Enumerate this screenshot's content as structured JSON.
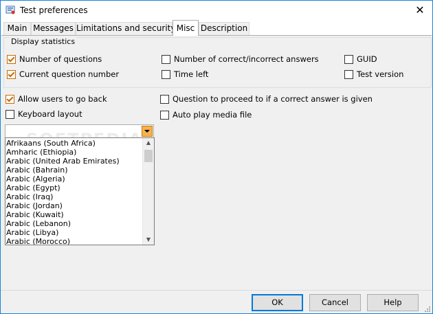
{
  "window": {
    "title": "Test preferences"
  },
  "tabs": [
    {
      "label": "Main",
      "active": false
    },
    {
      "label": "Messages",
      "active": false
    },
    {
      "label": "Limitations and security",
      "active": false
    },
    {
      "label": "Misc",
      "active": true
    },
    {
      "label": "Description",
      "active": false
    }
  ],
  "display_statistics": {
    "label": "Display statistics",
    "items": [
      {
        "label": "Number of questions",
        "checked": true
      },
      {
        "label": "Current question number",
        "checked": true
      },
      {
        "label": "Number of correct/incorrect answers",
        "checked": false
      },
      {
        "label": "Time left",
        "checked": false
      },
      {
        "label": "GUID",
        "checked": false
      },
      {
        "label": "Test version",
        "checked": false
      }
    ]
  },
  "options": {
    "allow_back": {
      "label": "Allow users to go back",
      "checked": true
    },
    "keyboard_layout": {
      "label": "Keyboard layout",
      "checked": false
    },
    "question_proceed": {
      "label": "Question to proceed to if a correct answer is given",
      "checked": false
    },
    "auto_play": {
      "label": "Auto play media file",
      "checked": false
    }
  },
  "keyboard_combo": {
    "value": "",
    "options": [
      "Afrikaans (South Africa)",
      "Amharic (Ethiopia)",
      "Arabic (United Arab Emirates)",
      "Arabic (Bahrain)",
      "Arabic (Algeria)",
      "Arabic (Egypt)",
      "Arabic (Iraq)",
      "Arabic (Jordan)",
      "Arabic (Kuwait)",
      "Arabic (Lebanon)",
      "Arabic (Libya)",
      "Arabic (Morocco)"
    ]
  },
  "watermark": "SOFTPEDIA",
  "buttons": {
    "ok": "OK",
    "cancel": "Cancel",
    "help": "Help"
  },
  "colors": {
    "accent": "#0078d7",
    "check": "#c76a00",
    "combo_button": "#f6b24c"
  }
}
